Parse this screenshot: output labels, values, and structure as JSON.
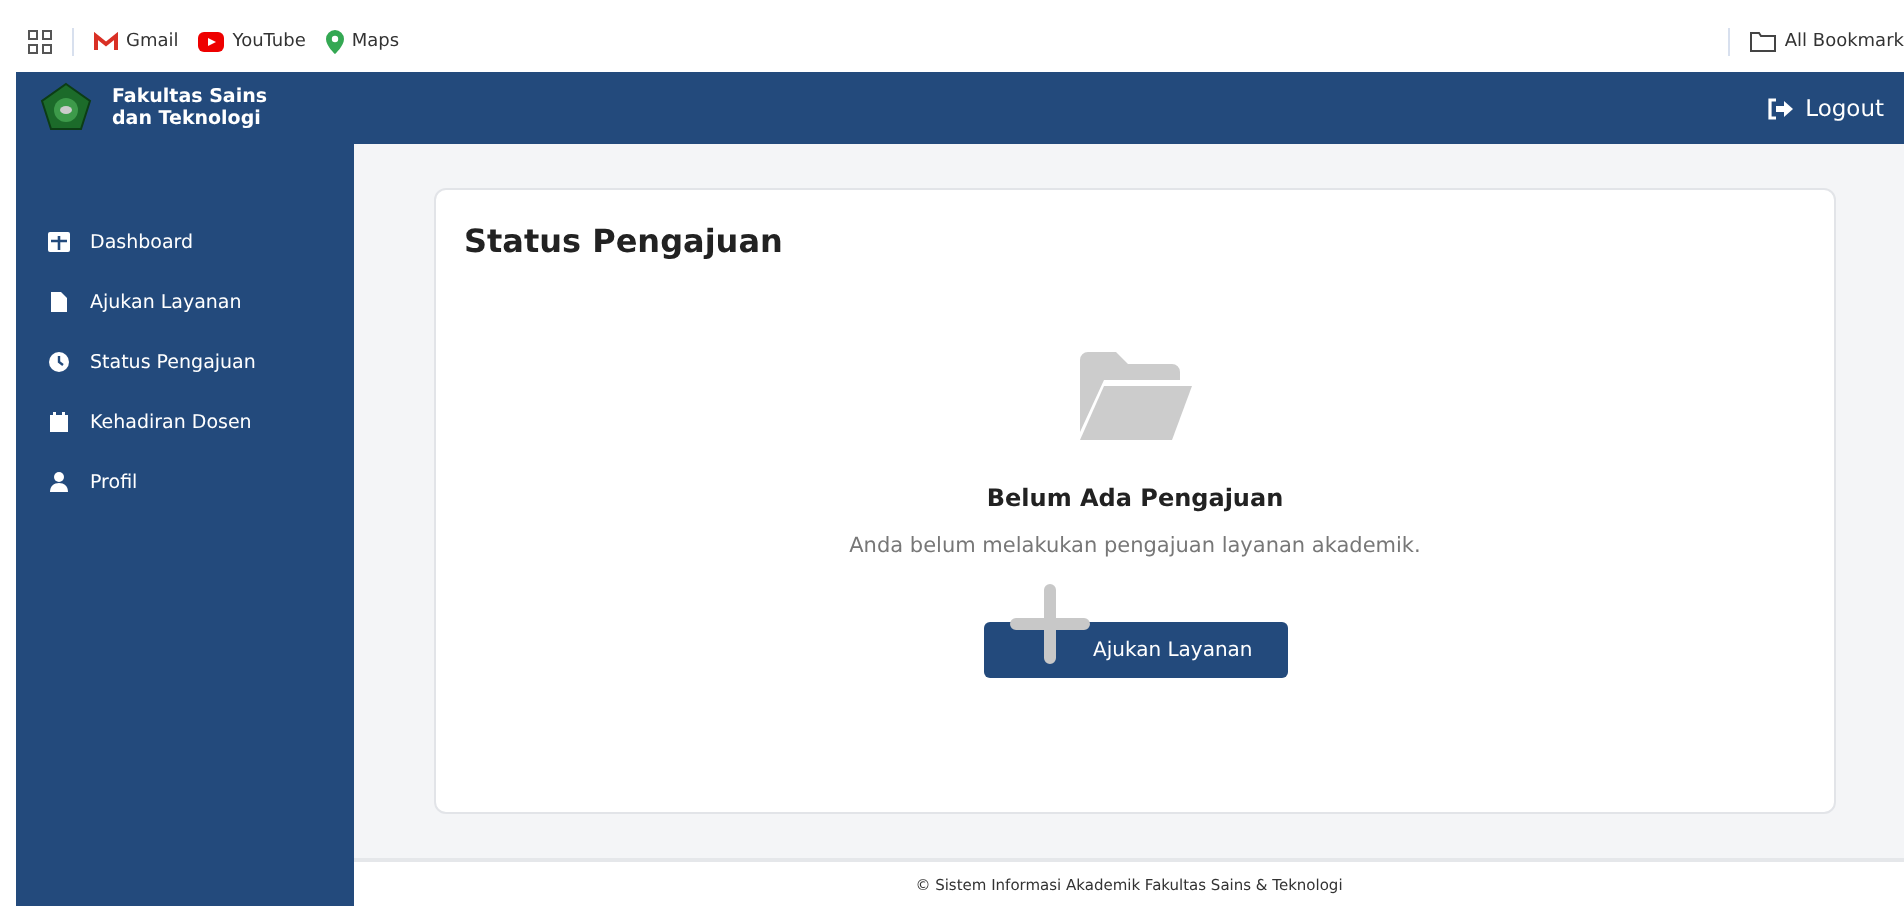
{
  "bookmarks_bar": {
    "items": [
      {
        "label": "Gmail",
        "kind": "gmail"
      },
      {
        "label": "YouTube",
        "kind": "youtube"
      },
      {
        "label": "Maps",
        "kind": "maps"
      }
    ],
    "all_bookmarks": "All Bookmark"
  },
  "header": {
    "brand_line_1": "Fakultas Sains",
    "brand_line_2": "dan Teknologi",
    "logout": "Logout"
  },
  "sidebar": {
    "items": [
      {
        "label": "Dashboard",
        "kind": "grid"
      },
      {
        "label": "Ajukan Layanan",
        "kind": "file"
      },
      {
        "label": "Status Pengajuan",
        "kind": "clock"
      },
      {
        "label": "Kehadiran Dosen",
        "kind": "calendar"
      },
      {
        "label": "Profil",
        "kind": "user"
      }
    ]
  },
  "card": {
    "title": "Status Pengajuan",
    "empty_title": "Belum Ada Pengajuan",
    "empty_text": "Anda belum melakukan pengajuan layanan akademik.",
    "button": "Ajukan Layanan"
  },
  "footer": "© Sistem Informasi Akademik Fakultas Sains & Teknologi"
}
